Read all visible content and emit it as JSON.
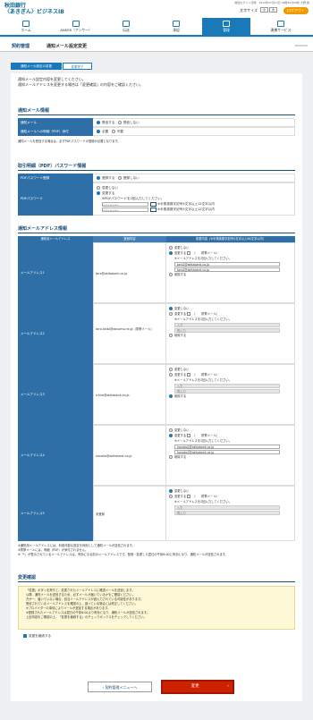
{
  "header": {
    "bank_name": "秋田銀行",
    "service_name": "〈あきぎん〉ビジネスIB",
    "last_login": "前回ログイン日時：2012年07月13日 09時30分00秒",
    "user_name": "大野 健",
    "font_size_label": "文字サイズ",
    "font_size_small": "小",
    "font_size_large": "大",
    "logout_label": "ログアウト"
  },
  "nav": {
    "items": [
      {
        "label": "ホーム"
      },
      {
        "label": "ANSER（アンサー）"
      },
      {
        "label": "伝送"
      },
      {
        "label": "承認"
      },
      {
        "label": "管理"
      },
      {
        "label": "連携サービス"
      }
    ]
  },
  "page": {
    "breadcrumb": "契約管理",
    "title": "通知メール設定変更",
    "screen_id": "BKKR006"
  },
  "steps": [
    "通知メール設定の変更",
    "変更完了"
  ],
  "intro": [
    "通知メール設定内容を変更してください。",
    "通知メールアドレスを変更する場合は「変更確認」の内容をご確認ください。"
  ],
  "notify": {
    "section_title": "通知メール情報",
    "row1_label": "通知メール",
    "row1_opt_on": "受信する",
    "row1_opt_off": "受信しない",
    "row2_label": "通知メールへの明細（PDF）添付",
    "row2_opt_on": "必要",
    "row2_opt_off": "不要",
    "note": "通知メールを受信する場合は、必ずPDFパスワードの登録が必要となります。"
  },
  "pdf": {
    "section_title": "取引明細（PDF）パスワード情報",
    "row1_label": "PDFパスワード登録",
    "row1_opt_on": "登録する",
    "row1_opt_off": "登録しない",
    "row2_label": "PDFパスワード",
    "opt_nochange": "変更しない",
    "opt_change": "変更する",
    "note": "※PDFパスワードを2回入力してください。",
    "hint1": "※半角英数字記号4文字以上12文字以内",
    "hint2": "※半角英数字記号4文字以上12文字以内",
    "mask": "••••••••••"
  },
  "address": {
    "section_title": "通知メールアドレス情報",
    "col1": "通知用メールアドレス",
    "col2": "登録内容",
    "col3": "変更内容（※半角英数字記号4文字以上64文字以内）",
    "opt_nochange": "変更しない",
    "opt_change": "変更する",
    "opt_mobile": "（　　携帯メール）",
    "opt_delete": "削除する",
    "instr": "※メールアドレスを2回入力してください。",
    "input_label": "入力",
    "reinput_label": "再入力",
    "rows": [
      {
        "label": "メールアドレス1",
        "current": "taro@akitabank.co.jp",
        "value1": "taro2@akitabank.co.jp",
        "value2": "taro2@akitabank.co.jp"
      },
      {
        "label": "メールアドレス2",
        "current": "taro-akita@docomo.ne.jp（携帯メール）",
        "value1": "",
        "value2": ""
      },
      {
        "label": "メールアドレス3",
        "current": "ichiro@akitabank.co.jp",
        "value1": "",
        "value2": ""
      },
      {
        "label": "メールアドレス4",
        "current": "hanako@akitabank.co.jp",
        "value1": "hanako2@akitabank.co.jp",
        "value2": "hanako2@akitabank.co.jp"
      },
      {
        "label": "メールアドレス5",
        "current": "未登録",
        "value1": "",
        "value2": ""
      }
    ]
  },
  "footnotes": [
    "※通知用メールアドレスには、利用可能な設定を利用として通知メールが送信されます。",
    "※携帯メールには、明細（PDF）が添付されません。",
    "※「*」が表示されているメールアドレスは、有効になる前のメールアドレスです。登録・変更した翌日の午前6:00に有効となり、通知メールが送信されます。"
  ],
  "confirm": {
    "section_title": "変更確認",
    "lines": [
      "「変更」ボタンを押すと、変更されたメールアドレスに確認メールを送信します。",
      "以降、通知メールを送信するため、必ずメールが届いているかをご確認ください。",
      "万が一、届いていない場合、該当メールアドレスが誤入力されている可能性があります。",
      "受信されているメールアドレスを確認の上、誤っている場合には修正してください。",
      "※プロバイダーの事情によりメールが遅延する場合があります。",
      "※登録されたメールアドレスは翌日の午前6:00より有効となり、通知メールが送信されます。",
      "上記内容をご確認の上、「変更を継続する」のチェックボックスをチェックしてください。"
    ],
    "checkbox_label": "変更を継続する"
  },
  "buttons": {
    "back": "契約管理メニューへ",
    "next": "変更"
  },
  "colors": {
    "primary": "#1a79b8",
    "label_bg": "#2e6fa8",
    "accent": "#cc2200",
    "logout": "#f19a00"
  }
}
